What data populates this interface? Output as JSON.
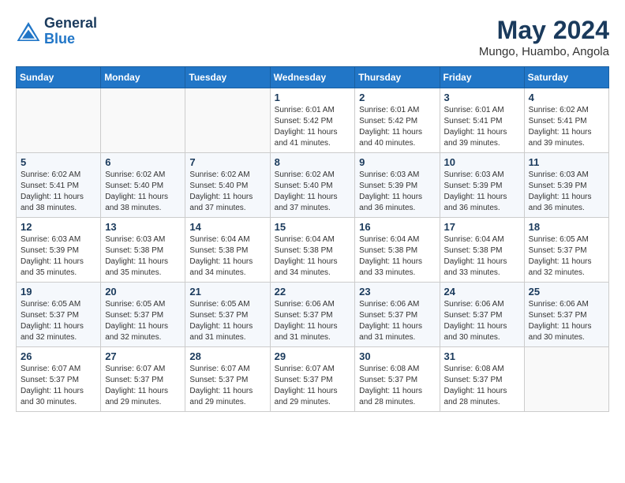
{
  "header": {
    "logo_line1": "General",
    "logo_line2": "Blue",
    "month": "May 2024",
    "location": "Mungo, Huambo, Angola"
  },
  "weekdays": [
    "Sunday",
    "Monday",
    "Tuesday",
    "Wednesday",
    "Thursday",
    "Friday",
    "Saturday"
  ],
  "weeks": [
    [
      {
        "day": "",
        "info": ""
      },
      {
        "day": "",
        "info": ""
      },
      {
        "day": "",
        "info": ""
      },
      {
        "day": "1",
        "info": "Sunrise: 6:01 AM\nSunset: 5:42 PM\nDaylight: 11 hours and 41 minutes."
      },
      {
        "day": "2",
        "info": "Sunrise: 6:01 AM\nSunset: 5:42 PM\nDaylight: 11 hours and 40 minutes."
      },
      {
        "day": "3",
        "info": "Sunrise: 6:01 AM\nSunset: 5:41 PM\nDaylight: 11 hours and 39 minutes."
      },
      {
        "day": "4",
        "info": "Sunrise: 6:02 AM\nSunset: 5:41 PM\nDaylight: 11 hours and 39 minutes."
      }
    ],
    [
      {
        "day": "5",
        "info": "Sunrise: 6:02 AM\nSunset: 5:41 PM\nDaylight: 11 hours and 38 minutes."
      },
      {
        "day": "6",
        "info": "Sunrise: 6:02 AM\nSunset: 5:40 PM\nDaylight: 11 hours and 38 minutes."
      },
      {
        "day": "7",
        "info": "Sunrise: 6:02 AM\nSunset: 5:40 PM\nDaylight: 11 hours and 37 minutes."
      },
      {
        "day": "8",
        "info": "Sunrise: 6:02 AM\nSunset: 5:40 PM\nDaylight: 11 hours and 37 minutes."
      },
      {
        "day": "9",
        "info": "Sunrise: 6:03 AM\nSunset: 5:39 PM\nDaylight: 11 hours and 36 minutes."
      },
      {
        "day": "10",
        "info": "Sunrise: 6:03 AM\nSunset: 5:39 PM\nDaylight: 11 hours and 36 minutes."
      },
      {
        "day": "11",
        "info": "Sunrise: 6:03 AM\nSunset: 5:39 PM\nDaylight: 11 hours and 36 minutes."
      }
    ],
    [
      {
        "day": "12",
        "info": "Sunrise: 6:03 AM\nSunset: 5:39 PM\nDaylight: 11 hours and 35 minutes."
      },
      {
        "day": "13",
        "info": "Sunrise: 6:03 AM\nSunset: 5:38 PM\nDaylight: 11 hours and 35 minutes."
      },
      {
        "day": "14",
        "info": "Sunrise: 6:04 AM\nSunset: 5:38 PM\nDaylight: 11 hours and 34 minutes."
      },
      {
        "day": "15",
        "info": "Sunrise: 6:04 AM\nSunset: 5:38 PM\nDaylight: 11 hours and 34 minutes."
      },
      {
        "day": "16",
        "info": "Sunrise: 6:04 AM\nSunset: 5:38 PM\nDaylight: 11 hours and 33 minutes."
      },
      {
        "day": "17",
        "info": "Sunrise: 6:04 AM\nSunset: 5:38 PM\nDaylight: 11 hours and 33 minutes."
      },
      {
        "day": "18",
        "info": "Sunrise: 6:05 AM\nSunset: 5:37 PM\nDaylight: 11 hours and 32 minutes."
      }
    ],
    [
      {
        "day": "19",
        "info": "Sunrise: 6:05 AM\nSunset: 5:37 PM\nDaylight: 11 hours and 32 minutes."
      },
      {
        "day": "20",
        "info": "Sunrise: 6:05 AM\nSunset: 5:37 PM\nDaylight: 11 hours and 32 minutes."
      },
      {
        "day": "21",
        "info": "Sunrise: 6:05 AM\nSunset: 5:37 PM\nDaylight: 11 hours and 31 minutes."
      },
      {
        "day": "22",
        "info": "Sunrise: 6:06 AM\nSunset: 5:37 PM\nDaylight: 11 hours and 31 minutes."
      },
      {
        "day": "23",
        "info": "Sunrise: 6:06 AM\nSunset: 5:37 PM\nDaylight: 11 hours and 31 minutes."
      },
      {
        "day": "24",
        "info": "Sunrise: 6:06 AM\nSunset: 5:37 PM\nDaylight: 11 hours and 30 minutes."
      },
      {
        "day": "25",
        "info": "Sunrise: 6:06 AM\nSunset: 5:37 PM\nDaylight: 11 hours and 30 minutes."
      }
    ],
    [
      {
        "day": "26",
        "info": "Sunrise: 6:07 AM\nSunset: 5:37 PM\nDaylight: 11 hours and 30 minutes."
      },
      {
        "day": "27",
        "info": "Sunrise: 6:07 AM\nSunset: 5:37 PM\nDaylight: 11 hours and 29 minutes."
      },
      {
        "day": "28",
        "info": "Sunrise: 6:07 AM\nSunset: 5:37 PM\nDaylight: 11 hours and 29 minutes."
      },
      {
        "day": "29",
        "info": "Sunrise: 6:07 AM\nSunset: 5:37 PM\nDaylight: 11 hours and 29 minutes."
      },
      {
        "day": "30",
        "info": "Sunrise: 6:08 AM\nSunset: 5:37 PM\nDaylight: 11 hours and 28 minutes."
      },
      {
        "day": "31",
        "info": "Sunrise: 6:08 AM\nSunset: 5:37 PM\nDaylight: 11 hours and 28 minutes."
      },
      {
        "day": "",
        "info": ""
      }
    ]
  ]
}
